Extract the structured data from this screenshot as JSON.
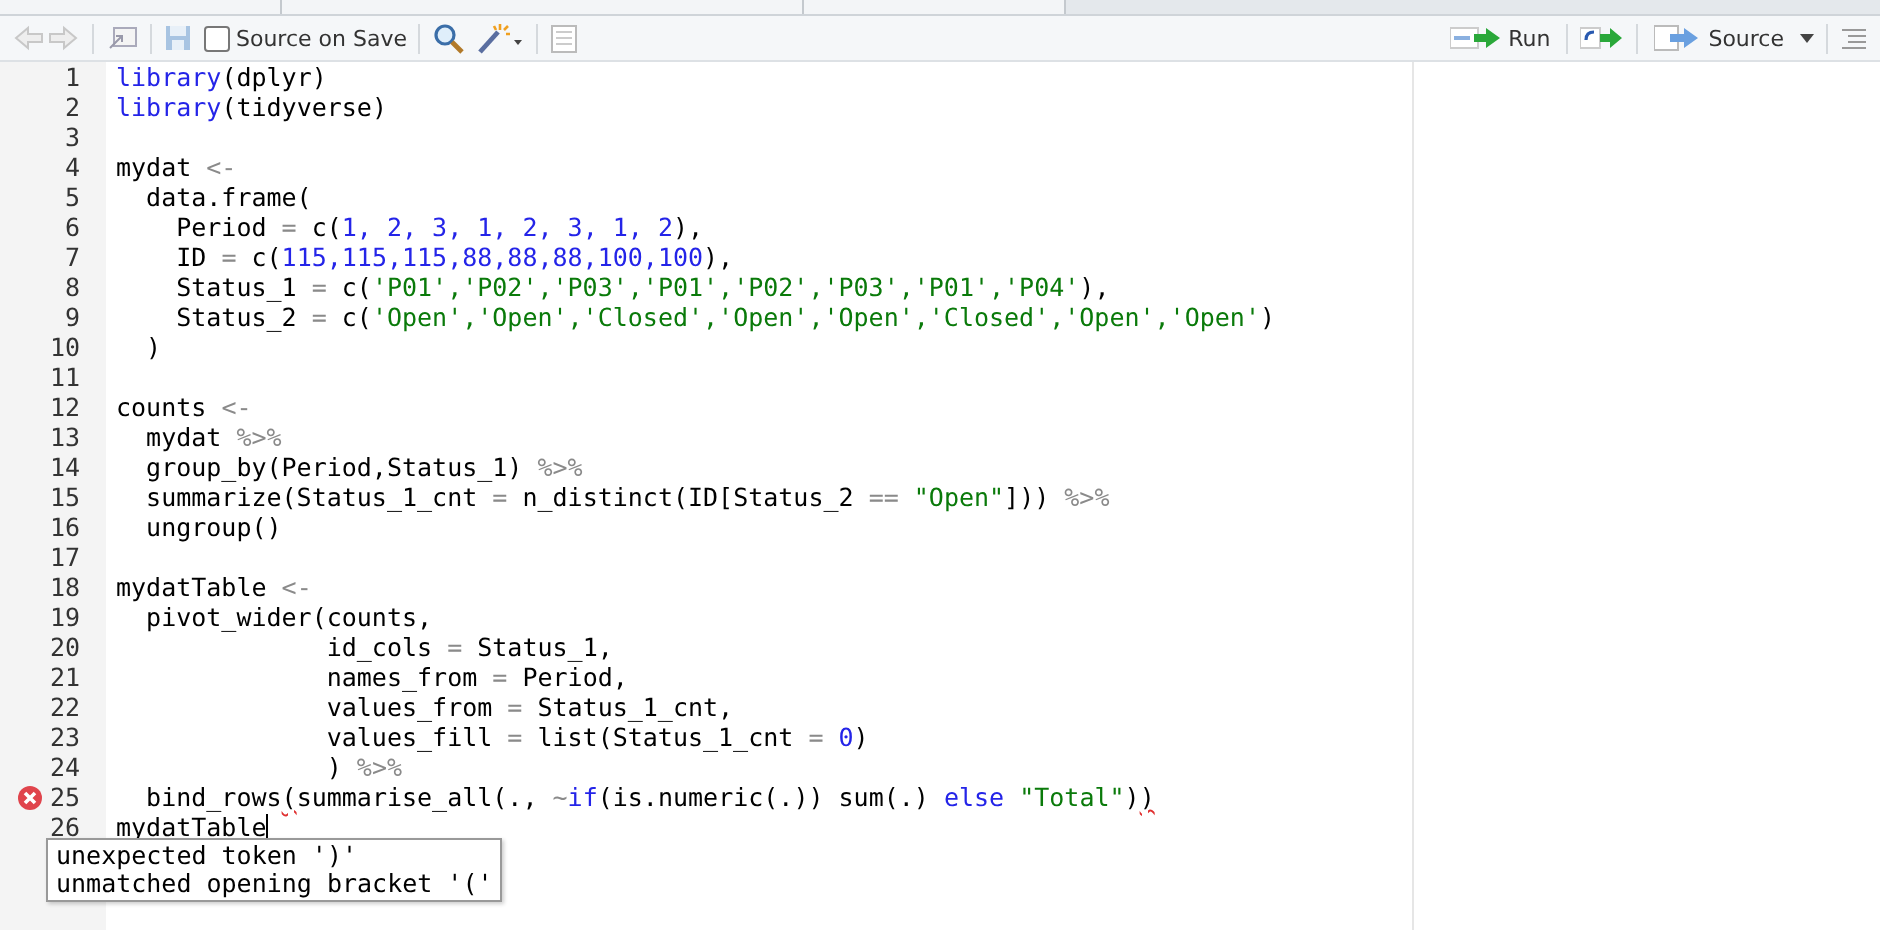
{
  "toolbar": {
    "source_on_save": {
      "label": "Source on Save",
      "checked": false
    },
    "run": {
      "label": "Run"
    },
    "source": {
      "label": "Source"
    }
  },
  "lines": [
    {
      "number": "1",
      "error": false,
      "cursor": false,
      "tokens": [
        {
          "kind": "keyword",
          "text": "library"
        },
        {
          "kind": "plain",
          "text": "(dplyr)"
        }
      ]
    },
    {
      "number": "2",
      "error": false,
      "cursor": false,
      "tokens": [
        {
          "kind": "keyword",
          "text": "library"
        },
        {
          "kind": "plain",
          "text": "(tidyverse)"
        }
      ]
    },
    {
      "number": "3",
      "error": false,
      "cursor": false
    },
    {
      "number": "4",
      "error": false,
      "cursor": false,
      "tokens": [
        {
          "kind": "plain",
          "text": "mydat "
        },
        {
          "kind": "operator",
          "text": "<-"
        }
      ]
    },
    {
      "number": "5",
      "error": false,
      "cursor": false,
      "tokens": [
        {
          "kind": "plain",
          "text": "  data.frame("
        }
      ]
    },
    {
      "number": "6",
      "error": false,
      "cursor": false,
      "tokens": [
        {
          "kind": "plain",
          "text": "    Period "
        },
        {
          "kind": "operator",
          "text": "="
        },
        {
          "kind": "plain",
          "text": " c("
        },
        {
          "kind": "number",
          "text": "1, 2, 3, 1, 2, 3, 1, 2"
        },
        {
          "kind": "plain",
          "text": "),"
        }
      ]
    },
    {
      "number": "7",
      "error": false,
      "cursor": false,
      "tokens": [
        {
          "kind": "plain",
          "text": "    ID "
        },
        {
          "kind": "operator",
          "text": "="
        },
        {
          "kind": "plain",
          "text": " c("
        },
        {
          "kind": "number",
          "text": "115,115,115,88,88,88,100,100"
        },
        {
          "kind": "plain",
          "text": "),"
        }
      ]
    },
    {
      "number": "8",
      "error": false,
      "cursor": false,
      "tokens": [
        {
          "kind": "plain",
          "text": "    Status_1 "
        },
        {
          "kind": "operator",
          "text": "="
        },
        {
          "kind": "plain",
          "text": " c("
        },
        {
          "kind": "string",
          "text": "'P01','P02','P03','P01','P02','P03','P01','P04'"
        },
        {
          "kind": "plain",
          "text": "),"
        }
      ]
    },
    {
      "number": "9",
      "error": false,
      "cursor": false,
      "tokens": [
        {
          "kind": "plain",
          "text": "    Status_2 "
        },
        {
          "kind": "operator",
          "text": "="
        },
        {
          "kind": "plain",
          "text": " c("
        },
        {
          "kind": "string",
          "text": "'Open','Open','Closed','Open','Open','Closed','Open','Open'"
        },
        {
          "kind": "plain",
          "text": ")"
        }
      ]
    },
    {
      "number": "10",
      "error": false,
      "cursor": false,
      "tokens": [
        {
          "kind": "plain",
          "text": "  )"
        }
      ]
    },
    {
      "number": "11",
      "error": false,
      "cursor": false
    },
    {
      "number": "12",
      "error": false,
      "cursor": false,
      "tokens": [
        {
          "kind": "plain",
          "text": "counts "
        },
        {
          "kind": "operator",
          "text": "<-"
        }
      ]
    },
    {
      "number": "13",
      "error": false,
      "cursor": false,
      "tokens": [
        {
          "kind": "plain",
          "text": "  mydat "
        },
        {
          "kind": "operator",
          "text": "%>%"
        }
      ]
    },
    {
      "number": "14",
      "error": false,
      "cursor": false,
      "tokens": [
        {
          "kind": "plain",
          "text": "  group_by(Period,Status_1) "
        },
        {
          "kind": "operator",
          "text": "%>%"
        }
      ]
    },
    {
      "number": "15",
      "error": false,
      "cursor": false,
      "tokens": [
        {
          "kind": "plain",
          "text": "  summarize(Status_1_cnt "
        },
        {
          "kind": "operator",
          "text": "="
        },
        {
          "kind": "plain",
          "text": " n_distinct(ID[Status_2 "
        },
        {
          "kind": "operator",
          "text": "== "
        },
        {
          "kind": "string",
          "text": "\"Open\""
        },
        {
          "kind": "plain",
          "text": "])) "
        },
        {
          "kind": "operator",
          "text": "%>%"
        }
      ]
    },
    {
      "number": "16",
      "error": false,
      "cursor": false,
      "tokens": [
        {
          "kind": "plain",
          "text": "  ungroup()"
        }
      ]
    },
    {
      "number": "17",
      "error": false,
      "cursor": false
    },
    {
      "number": "18",
      "error": false,
      "cursor": false,
      "tokens": [
        {
          "kind": "plain",
          "text": "mydatTable "
        },
        {
          "kind": "operator",
          "text": "<-"
        }
      ]
    },
    {
      "number": "19",
      "error": false,
      "cursor": false,
      "tokens": [
        {
          "kind": "plain",
          "text": "  pivot_wider(counts,"
        }
      ]
    },
    {
      "number": "20",
      "error": false,
      "cursor": false,
      "tokens": [
        {
          "kind": "plain",
          "text": "              id_cols "
        },
        {
          "kind": "operator",
          "text": "="
        },
        {
          "kind": "plain",
          "text": " Status_1,"
        }
      ]
    },
    {
      "number": "21",
      "error": false,
      "cursor": false,
      "tokens": [
        {
          "kind": "plain",
          "text": "              names_from "
        },
        {
          "kind": "operator",
          "text": "="
        },
        {
          "kind": "plain",
          "text": " Period,"
        }
      ]
    },
    {
      "number": "22",
      "error": false,
      "cursor": false,
      "tokens": [
        {
          "kind": "plain",
          "text": "              values_from "
        },
        {
          "kind": "operator",
          "text": "="
        },
        {
          "kind": "plain",
          "text": " Status_1_cnt,"
        }
      ]
    },
    {
      "number": "23",
      "error": false,
      "cursor": false,
      "tokens": [
        {
          "kind": "plain",
          "text": "              values_fill "
        },
        {
          "kind": "operator",
          "text": "="
        },
        {
          "kind": "plain",
          "text": " list(Status_1_cnt "
        },
        {
          "kind": "operator",
          "text": "= "
        },
        {
          "kind": "number",
          "text": "0"
        },
        {
          "kind": "plain",
          "text": ")"
        }
      ]
    },
    {
      "number": "24",
      "error": false,
      "cursor": false,
      "tokens": [
        {
          "kind": "plain",
          "text": "              ) "
        },
        {
          "kind": "operator",
          "text": "%>%"
        }
      ]
    },
    {
      "number": "25",
      "error": true,
      "cursor": false,
      "tokens": [
        {
          "kind": "plain",
          "text": "  bind_rows"
        },
        {
          "kind": "flagged",
          "text": "("
        },
        {
          "kind": "plain",
          "text": "summarise_all(., "
        },
        {
          "kind": "operator",
          "text": "~"
        },
        {
          "kind": "keyword",
          "text": "if"
        },
        {
          "kind": "plain",
          "text": "(is.numeric(.)) sum(.) "
        },
        {
          "kind": "keyword",
          "text": "else "
        },
        {
          "kind": "string",
          "text": "\"Total\""
        },
        {
          "kind": "plain",
          "text": ")"
        },
        {
          "kind": "flagged",
          "text": ")"
        }
      ]
    },
    {
      "number": "26",
      "error": false,
      "cursor": true,
      "tokens": [
        {
          "kind": "plain",
          "text": "mydatTable"
        }
      ]
    }
  ],
  "tooltip": {
    "lines": [
      "unexpected token ')'",
      "unmatched opening bracket '('"
    ]
  }
}
